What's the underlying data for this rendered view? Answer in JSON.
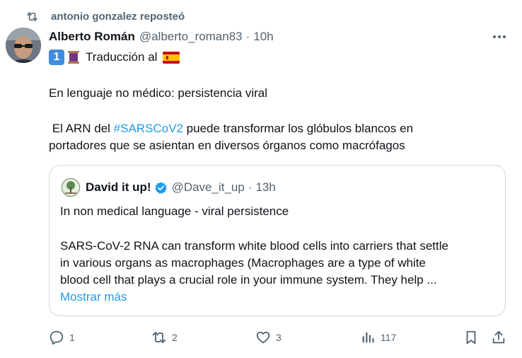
{
  "repost": {
    "text": "antonio gonzalez reposteó"
  },
  "tweet": {
    "author_name": "Alberto Román",
    "author_handle": "@alberto_roman83",
    "separator": "·",
    "time": "10h",
    "line1_emoji_number": "1",
    "line1_text": "Traducción al",
    "line2": "En lenguaje no médico: persistencia viral",
    "line3_prefix": " El ARN del ",
    "line3_hashtag": "#SARSCoV2",
    "line3_suffix": " puede transformar los glóbulos blancos en",
    "line4": "portadores que se asientan en diversos órganos como macrófagos"
  },
  "quote": {
    "author_name": "David it up!",
    "author_handle": "@Dave_it_up",
    "separator": "·",
    "time": "13h",
    "line1": "In non medical language - viral persistence",
    "line2": "SARS-CoV-2 RNA can transform white blood cells into carriers that settle",
    "line3": "in various organs as macrophages (Macrophages are a type of white",
    "line4": "blood cell that plays a crucial role in your immune system. They help ...",
    "show_more": "Mostrar más"
  },
  "actions": {
    "replies": "1",
    "reposts": "2",
    "likes": "3",
    "views": "117"
  },
  "icons": {
    "repost": "repost-icon",
    "more": "more-icon",
    "reply": "reply-icon",
    "like": "heart-icon",
    "views": "views-icon",
    "bookmark": "bookmark-icon",
    "share": "share-icon",
    "verified": "verified-badge-icon"
  },
  "colors": {
    "accent": "#1d9bf0",
    "secondary_text": "#536471",
    "border": "#cfd9de",
    "text": "#0f1419"
  }
}
